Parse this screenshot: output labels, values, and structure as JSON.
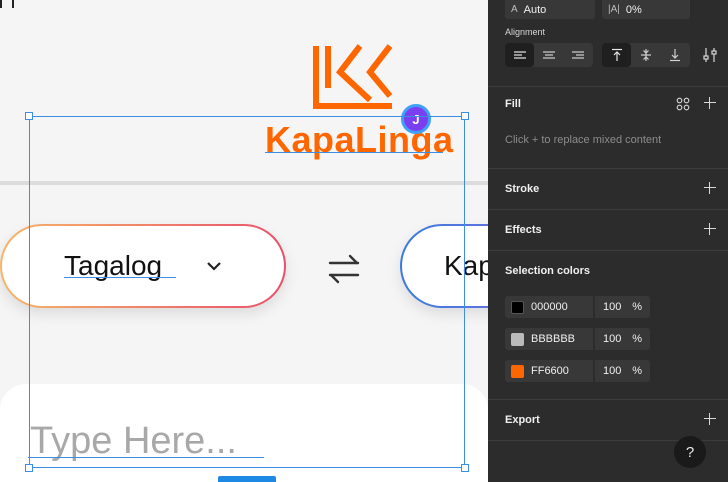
{
  "canvas": {
    "brand": {
      "name": "KapaLinga",
      "color": "#FF6600"
    },
    "avatar_initial": "J",
    "source_language": "Tagalog",
    "target_language_partial": "Kap",
    "input_placeholder": "Type Here..."
  },
  "panel": {
    "top_fields": {
      "line_height": "Auto",
      "letter_spacing": "0%"
    },
    "alignment": {
      "title": "Alignment"
    },
    "fill": {
      "title": "Fill",
      "hint": "Click + to replace mixed content"
    },
    "stroke": {
      "title": "Stroke"
    },
    "effects": {
      "title": "Effects"
    },
    "selection_colors": {
      "title": "Selection colors",
      "items": [
        {
          "hex": "000000",
          "swatch": "#000000",
          "opacity": "100",
          "unit": "%"
        },
        {
          "hex": "BBBBBB",
          "swatch": "#BBBBBB",
          "opacity": "100",
          "unit": "%"
        },
        {
          "hex": "FF6600",
          "swatch": "#FF6600",
          "opacity": "100",
          "unit": "%"
        }
      ]
    },
    "export": {
      "title": "Export"
    },
    "help_label": "?"
  }
}
